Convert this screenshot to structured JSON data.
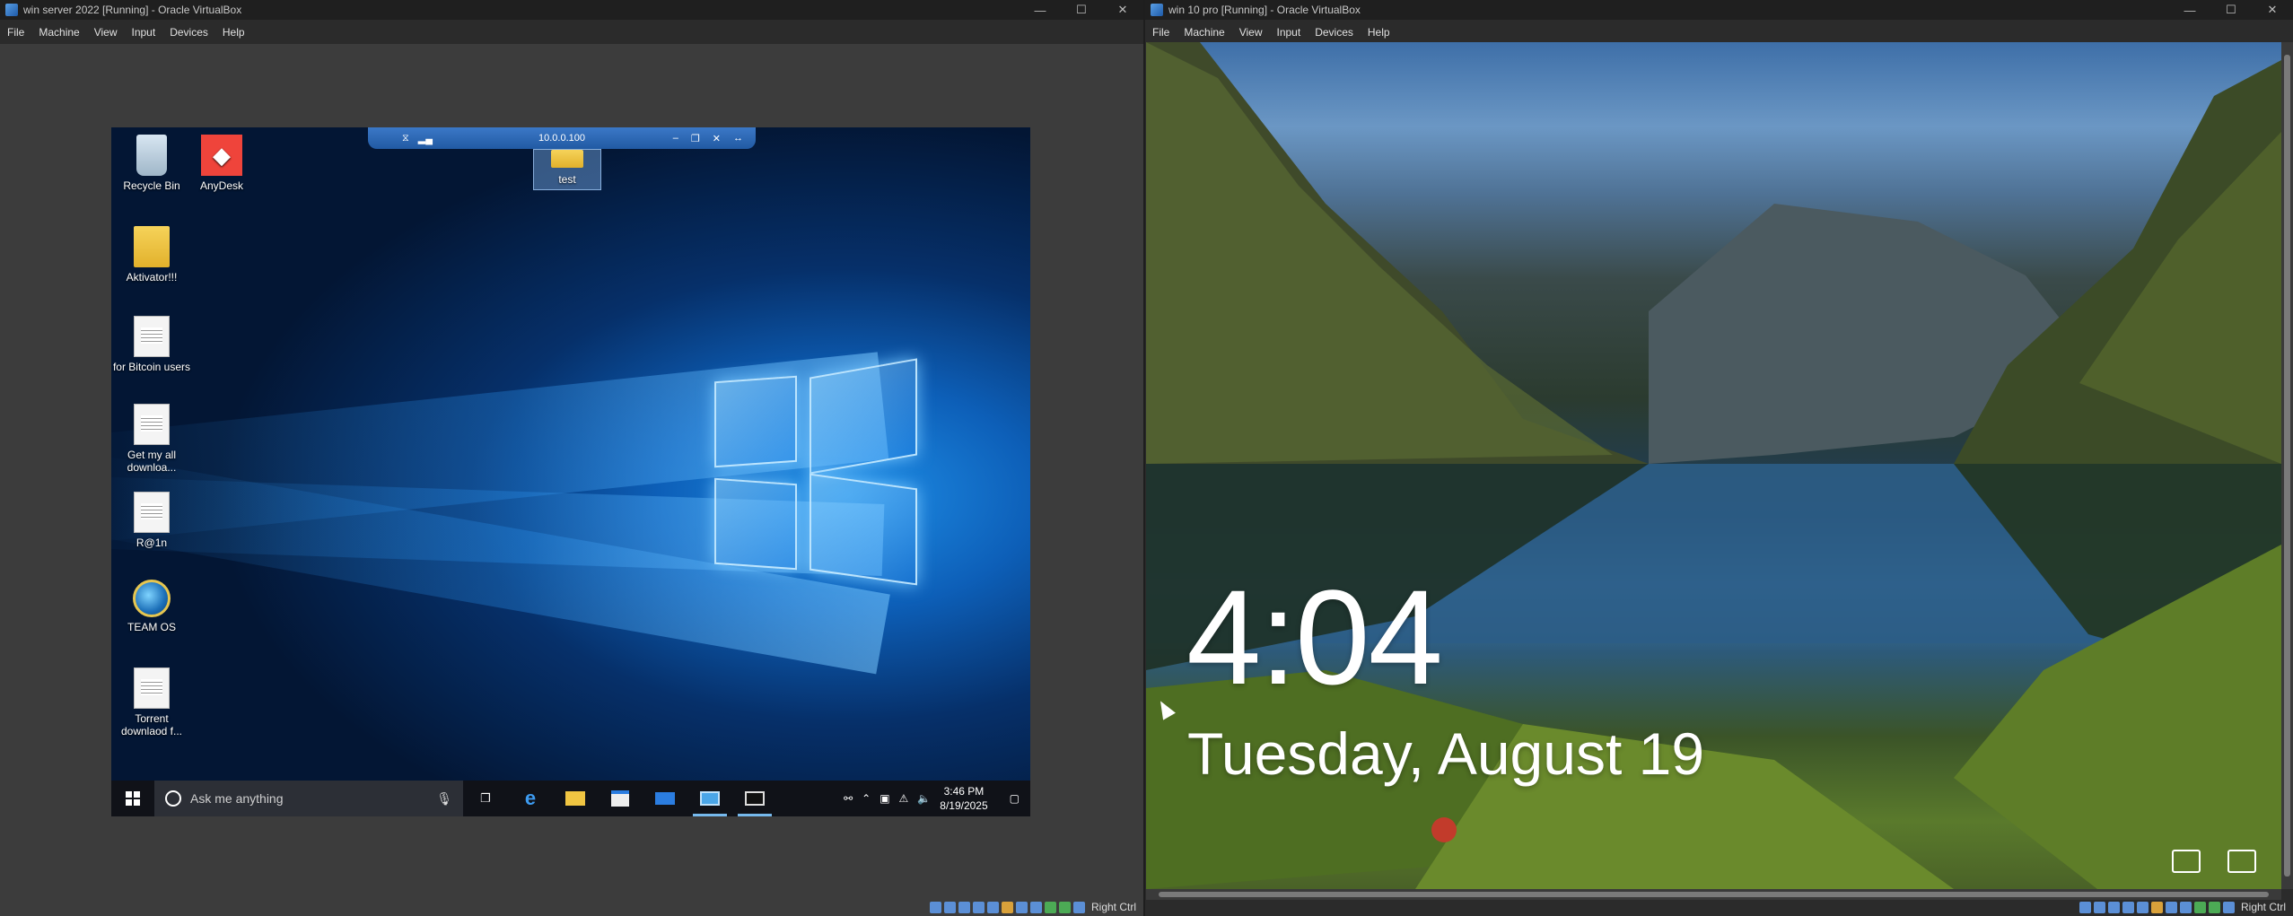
{
  "left_window": {
    "title": "win server 2022 [Running] - Oracle VirtualBox",
    "menu": [
      "File",
      "Machine",
      "View",
      "Input",
      "Devices",
      "Help"
    ],
    "host_key": "Right Ctrl",
    "guest": {
      "remote_bar_host": "10.0.0.100",
      "desktop_icons": [
        {
          "label": "Recycle Bin",
          "icon": "recycle-bin-icon"
        },
        {
          "label": "AnyDesk",
          "icon": "anydesk-icon"
        },
        {
          "label": "test",
          "icon": "folder-icon"
        },
        {
          "label": "Aktivator!!!",
          "icon": "folder-icon"
        },
        {
          "label": "for Bitcoin users",
          "icon": "document-icon"
        },
        {
          "label": "Get my all downloa...",
          "icon": "document-icon"
        },
        {
          "label": "R@1n",
          "icon": "document-icon"
        },
        {
          "label": "TEAM OS",
          "icon": "globe-icon"
        },
        {
          "label": "Torrent downlaod f...",
          "icon": "document-icon"
        }
      ],
      "taskbar": {
        "search_placeholder": "Ask me anything",
        "time": "3:46 PM",
        "date": "8/19/2025"
      }
    }
  },
  "right_window": {
    "title": "win 10 pro [Running] - Oracle VirtualBox",
    "menu": [
      "File",
      "Machine",
      "View",
      "Input",
      "Devices",
      "Help"
    ],
    "host_key": "Right Ctrl",
    "lock_screen": {
      "time": "4:04",
      "date": "Tuesday, August 19"
    }
  },
  "colors": {
    "titlebar": "#1f1f1f",
    "host_bg": "#3c3c3c",
    "win10_blue": "#0d5fb8",
    "taskbar": "#101218"
  }
}
